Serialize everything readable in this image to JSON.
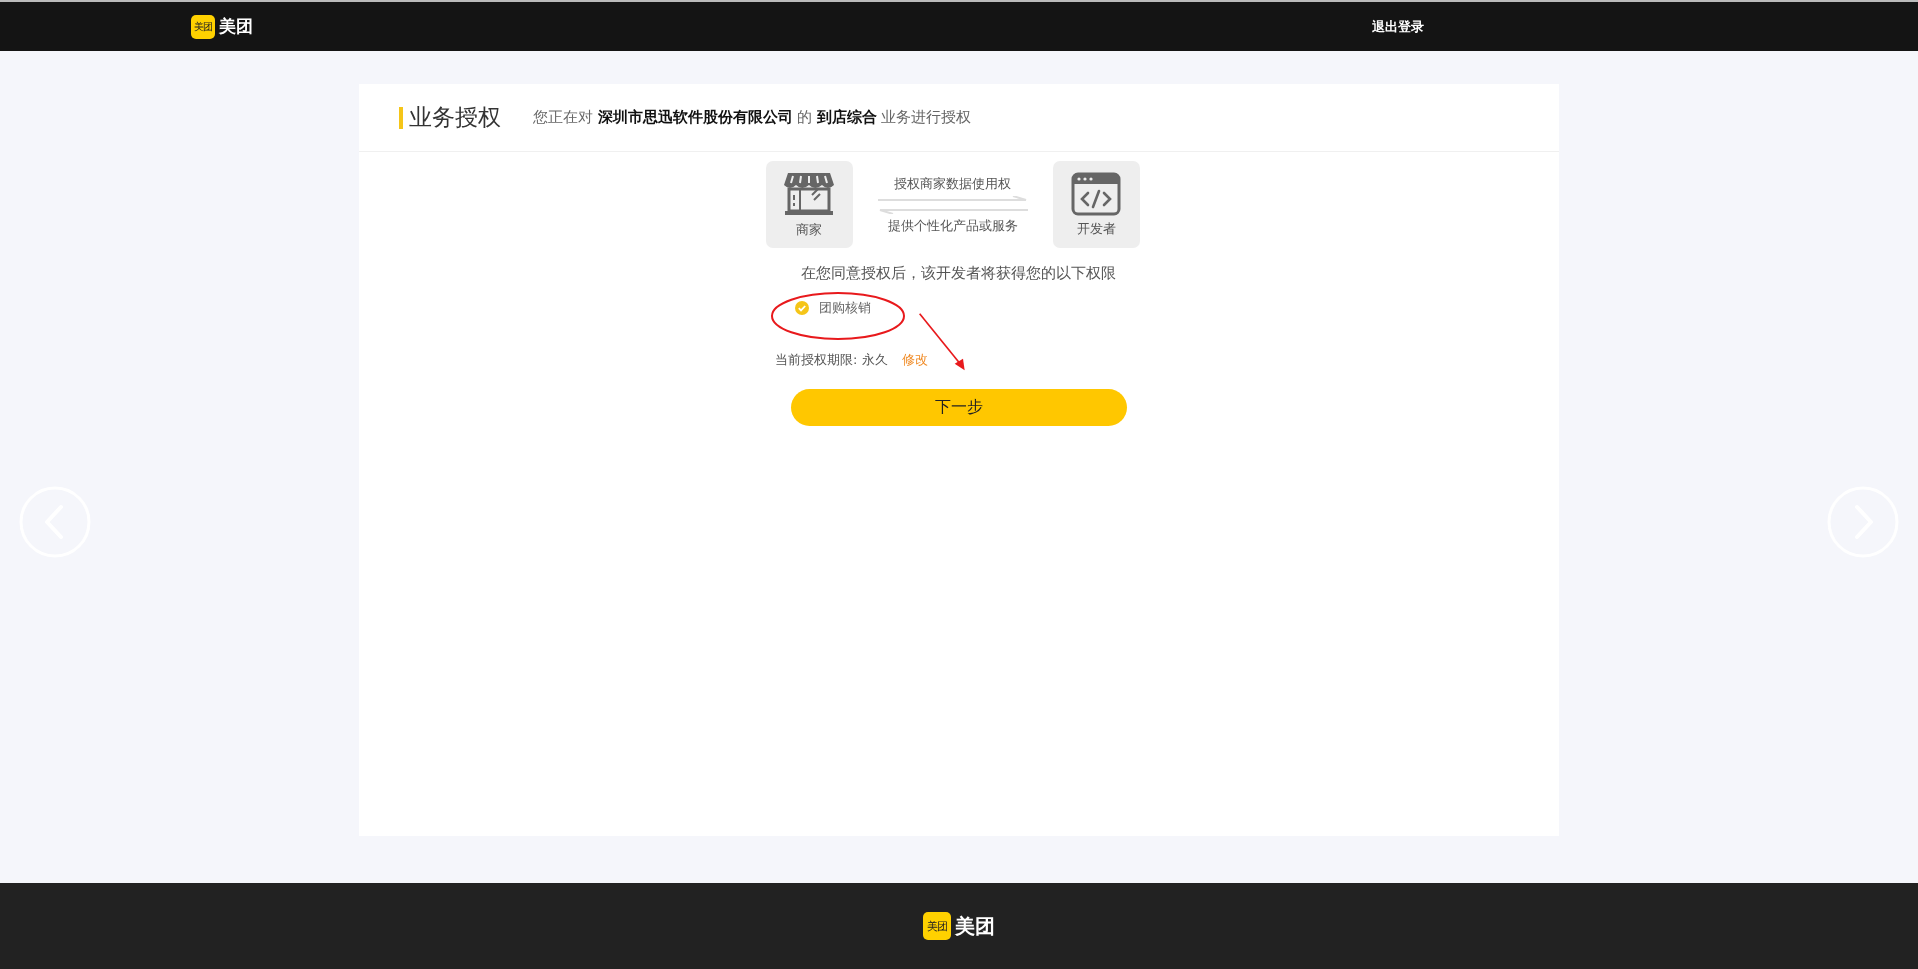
{
  "header": {
    "logo": {
      "badge": "美团",
      "wordmark": "美团"
    },
    "logout": "退出登录"
  },
  "card": {
    "title": "业务授权",
    "subtitle": "您正在对 **深圳市思迅软件股份有限公司** 的 **到店综合** 业务进行授权",
    "flow": {
      "merchant": "商家",
      "developer": "开发者",
      "forward": "授权商家数据使用权",
      "backward": "提供个性化产品或服务"
    },
    "intro": "在您同意授权后，该开发者将获得您的以下权限",
    "permissions": [
      {
        "label": "团购核销",
        "checked": true
      }
    ],
    "term": {
      "label": "当前授权期限: 永久",
      "edit": "修改"
    },
    "next_button": "下一步"
  },
  "footer": {
    "logo": {
      "badge": "美团",
      "wordmark": "美团"
    }
  }
}
